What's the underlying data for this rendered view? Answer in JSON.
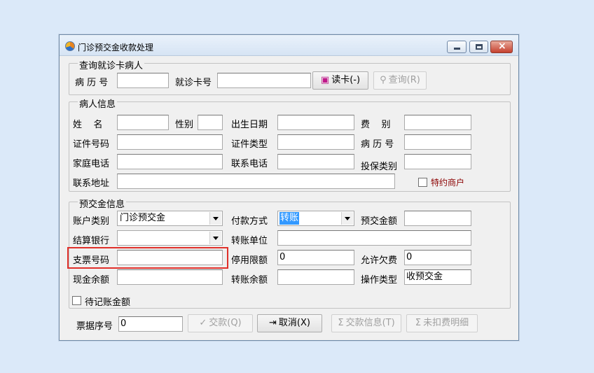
{
  "window": {
    "title": "门诊预交金收款处理",
    "controls": {
      "min": "minimize",
      "max": "maximize",
      "close": "×"
    }
  },
  "query_group": {
    "title": "查询就诊卡病人",
    "record_no_label": "病 历 号",
    "record_no_value": "",
    "card_no_label": "就诊卡号",
    "card_no_value": "",
    "read_card_button": "读卡(-)",
    "query_button": "查询(R)"
  },
  "patient_group": {
    "title": "病人信息",
    "name_label": "姓    名",
    "gender_label": "性别",
    "birth_label": "出生日期",
    "fee_type_label": "费    别",
    "id_no_label": "证件号码",
    "id_type_label": "证件类型",
    "record_no_label": "病 历 号",
    "home_phone_label": "家庭电话",
    "contact_phone_label": "联系电话",
    "insurance_label": "投保类别",
    "address_label": "联系地址",
    "special_merchant_label": "特约商户",
    "values": {
      "name": "",
      "gender": "",
      "birth": "",
      "fee_type": "",
      "id_no": "",
      "id_type": "",
      "record_no": "",
      "home_phone": "",
      "contact_phone": "",
      "insurance": "",
      "address": ""
    }
  },
  "deposit_group": {
    "title": "预交金信息",
    "account_type_label": "账户类别",
    "account_type_value": "门诊预交金",
    "payment_method_label": "付款方式",
    "payment_method_value": "转账",
    "deposit_amount_label": "预交金额",
    "deposit_amount_value": "",
    "bank_label": "结算银行",
    "bank_value": "",
    "transfer_unit_label": "转账单位",
    "transfer_unit_value": "",
    "check_no_label": "支票号码",
    "check_no_value": "",
    "stop_limit_label": "停用限额",
    "stop_limit_value": "0",
    "allow_owe_label": "允许欠费",
    "allow_owe_value": "0",
    "cash_balance_label": "现金余额",
    "cash_balance_value": "",
    "transfer_balance_label": "转账余额",
    "transfer_balance_value": "",
    "operation_type_label": "操作类型",
    "operation_type_value": "收预交金",
    "pending_amount_label": "待记账金额"
  },
  "footer": {
    "receipt_no_label": "票据序号",
    "receipt_no_value": "0",
    "pay_button": "交款(Q)",
    "cancel_button": "取消(X)",
    "pay_info_button": "交款信息(T)",
    "unpaid_detail_button": "未扣费明细"
  },
  "colors": {
    "highlight": "#e0302a",
    "selection": "#3399ff",
    "special_label": "#8b0000"
  }
}
